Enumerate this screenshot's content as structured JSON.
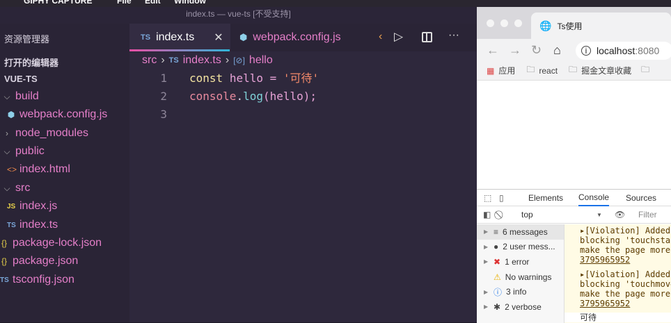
{
  "menubar": {
    "app": "GIPHY CAPTURE",
    "items": [
      "File",
      "Edit",
      "Window"
    ]
  },
  "vscode": {
    "window_title": "index.ts — vue-ts [不受支持]",
    "sidebar": {
      "title": "资源管理器",
      "open_editors": "打开的编辑器",
      "project": "VUE-TS",
      "items": [
        {
          "label": "build",
          "icon": "chevron-down",
          "kind": "folder"
        },
        {
          "label": "webpack.config.js",
          "icon": "webpack-cube",
          "kind": "file"
        },
        {
          "label": "node_modules",
          "icon": "chevron-right",
          "kind": "folder"
        },
        {
          "label": "public",
          "icon": "chevron-down",
          "kind": "folder"
        },
        {
          "label": "index.html",
          "icon": "html-brackets",
          "kind": "file"
        },
        {
          "label": "src",
          "icon": "chevron-down",
          "kind": "folder"
        },
        {
          "label": "index.js",
          "icon": "js",
          "kind": "file"
        },
        {
          "label": "index.ts",
          "icon": "ts",
          "kind": "file"
        },
        {
          "label": "package-lock.json",
          "icon": "json-braces",
          "kind": "file"
        },
        {
          "label": "package.json",
          "icon": "json-braces",
          "kind": "file"
        },
        {
          "label": "tsconfig.json",
          "icon": "ts",
          "kind": "file"
        }
      ]
    },
    "tabs": [
      {
        "label": "index.ts",
        "icon": "TS",
        "active": true
      },
      {
        "label": "webpack.config.js",
        "icon": "webpack-cube",
        "active": false
      }
    ],
    "breadcrumb": [
      "src",
      "index.ts",
      "hello"
    ],
    "ts_badge": "TS",
    "js_badge": "JS",
    "code": {
      "line_numbers": [
        "1",
        "2",
        "3"
      ],
      "line1": {
        "kw": "const",
        "name": "hello",
        "op": " = ",
        "str": "'可待'"
      },
      "line2": {
        "obj": "console",
        "dot": ".",
        "fn": "log",
        "args": "(hello);"
      }
    }
  },
  "browser": {
    "tab_title": "Ts使用",
    "url_host": "localhost",
    "url_port": ":8080",
    "bookmarks": [
      "应用",
      "react",
      "掘金文章收藏"
    ],
    "devtools": {
      "tabs": [
        "Elements",
        "Console",
        "Sources"
      ],
      "active_tab": "Console",
      "context": "top",
      "filter_placeholder": "Filter",
      "sidebar": [
        {
          "label": "6 messages",
          "icon": "list"
        },
        {
          "label": "2 user mess...",
          "icon": "user"
        },
        {
          "label": "1 error",
          "icon": "error"
        },
        {
          "label": "No warnings",
          "icon": "warning"
        },
        {
          "label": "3 info",
          "icon": "info"
        },
        {
          "label": "2 verbose",
          "icon": "bug"
        }
      ],
      "logs": [
        {
          "l1": "▸[Violation] Added",
          "l2": "blocking 'touchsta",
          "l3": "make the page more",
          "link": "3795965952"
        },
        {
          "l1": "▸[Violation] Added",
          "l2": "blocking 'touchmove",
          "l3": "make the page more",
          "link": "3795965952"
        }
      ],
      "output": "可待"
    }
  }
}
